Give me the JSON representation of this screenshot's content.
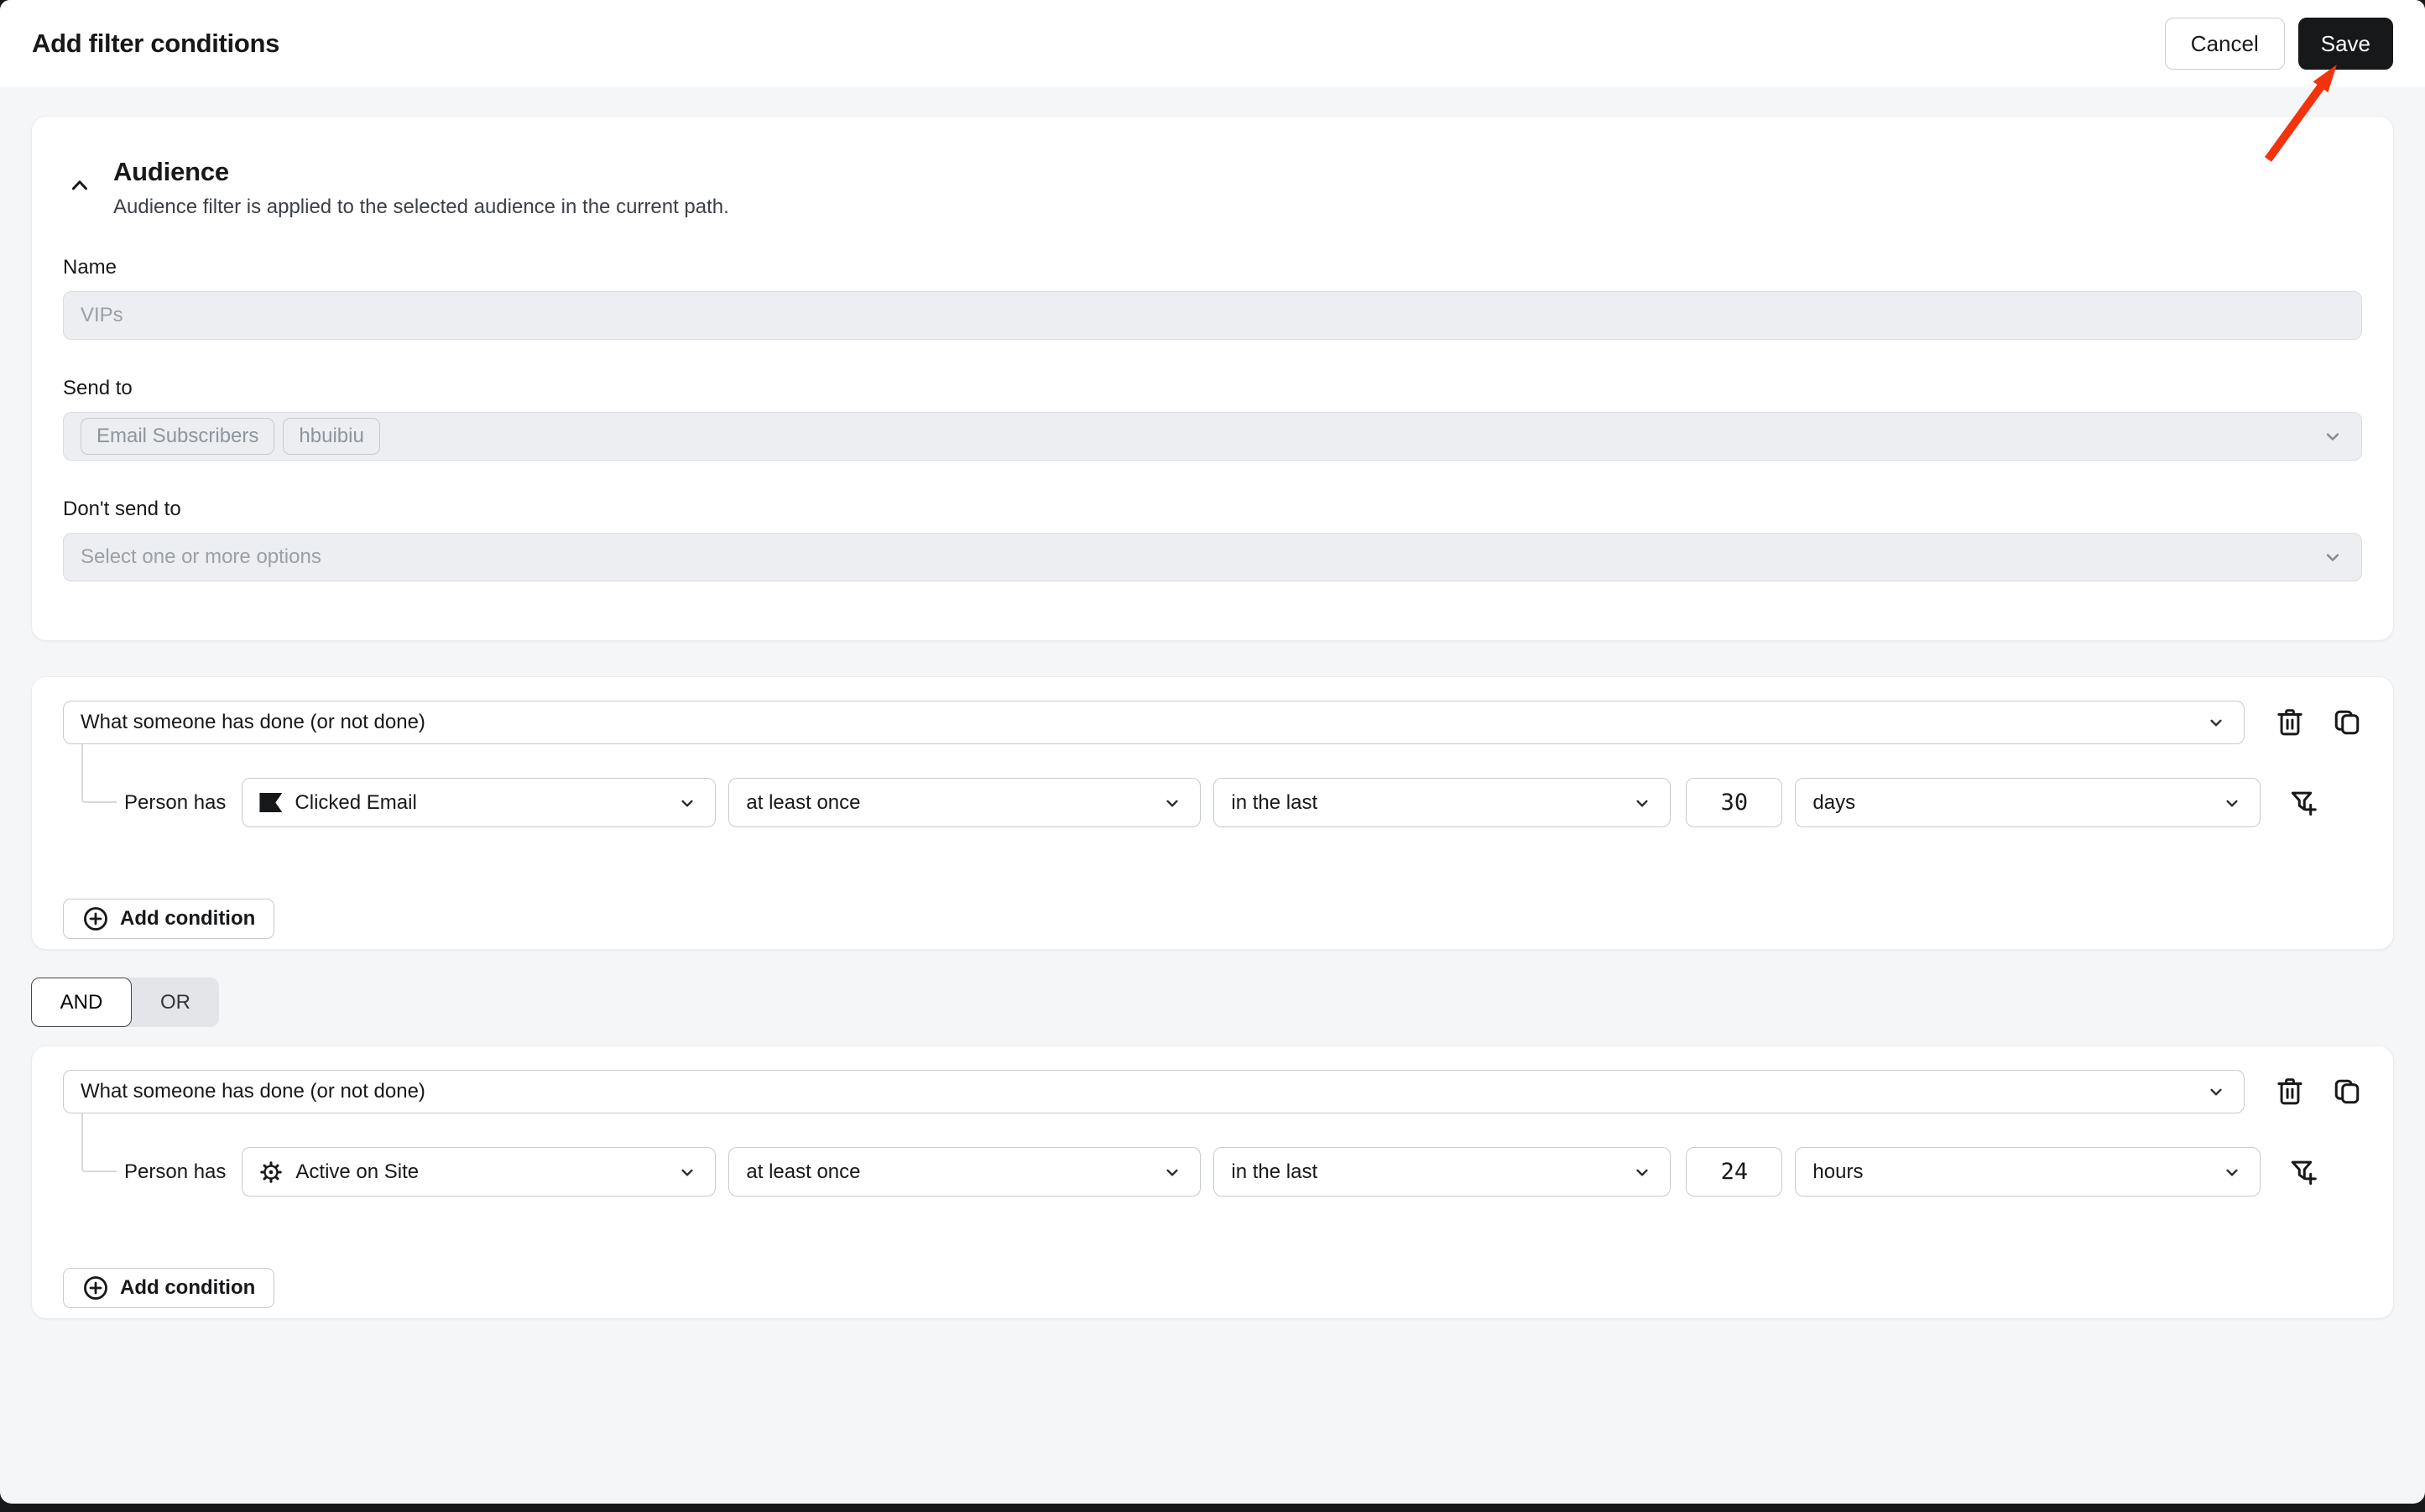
{
  "header": {
    "title": "Add filter conditions",
    "cancel_label": "Cancel",
    "save_label": "Save"
  },
  "audience": {
    "title": "Audience",
    "subtitle": "Audience filter is applied to the selected audience in the current path.",
    "name_label": "Name",
    "name_placeholder": "VIPs",
    "send_to_label": "Send to",
    "send_to_tags": [
      "Email Subscribers",
      "hbuibiu"
    ],
    "dont_send_to_label": "Don't send to",
    "dont_send_to_placeholder": "Select one or more options"
  },
  "logic_toggle": {
    "and_label": "AND",
    "or_label": "OR",
    "selected": "AND"
  },
  "conditions": [
    {
      "type_value": "What someone has done (or not done)",
      "row_label": "Person has",
      "metric": "Clicked Email",
      "metric_icon": "klaviyo-flag-icon",
      "frequency": "at least once",
      "timeframe": "in the last",
      "amount": "30",
      "unit": "days",
      "add_condition_label": "Add condition"
    },
    {
      "type_value": "What someone has done (or not done)",
      "row_label": "Person has",
      "metric": "Active on Site",
      "metric_icon": "gear-icon",
      "frequency": "at least once",
      "timeframe": "in the last",
      "amount": "24",
      "unit": "hours",
      "add_condition_label": "Add condition"
    }
  ],
  "colors": {
    "page_bg": "#f5f6f8",
    "card_bg": "#ffffff",
    "field_bg": "#eceef1",
    "border": "#c6cbd1",
    "save_button_bg": "#17181a",
    "arrow_accent": "#f2330d",
    "placeholder_text": "#9aa0a8",
    "backdrop": "#17181a"
  }
}
